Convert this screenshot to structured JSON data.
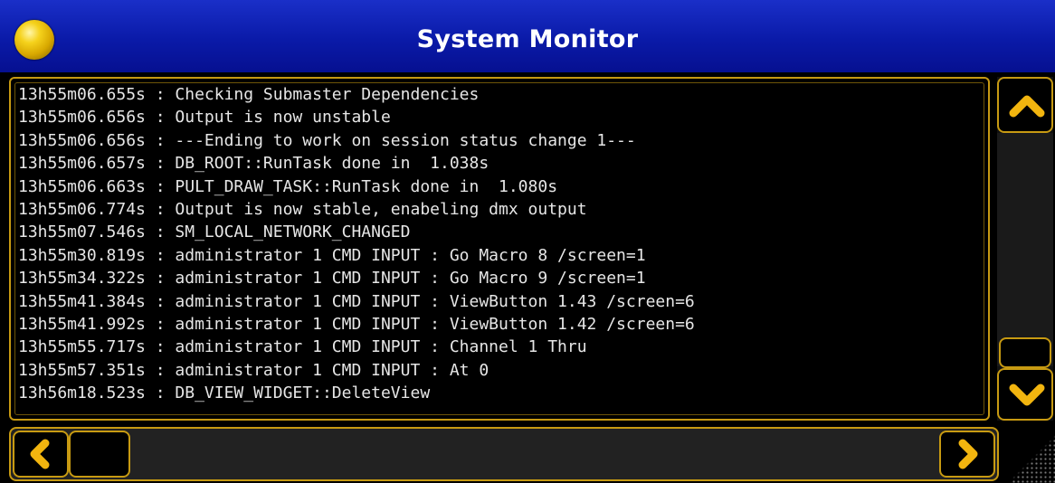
{
  "window": {
    "title": "System Monitor"
  },
  "log": {
    "lines": [
      "13h55m06.655s : Checking Submaster Dependencies",
      "13h55m06.656s : Output is now unstable",
      "13h55m06.656s : ---Ending to work on session status change 1---",
      "13h55m06.657s : DB_ROOT::RunTask done in  1.038s",
      "13h55m06.663s : PULT_DRAW_TASK::RunTask done in  1.080s",
      "13h55m06.774s : Output is now stable, enabeling dmx output",
      "13h55m07.546s : SM_LOCAL_NETWORK_CHANGED",
      "13h55m30.819s : administrator 1 CMD INPUT : Go Macro 8 /screen=1",
      "13h55m34.322s : administrator 1 CMD INPUT : Go Macro 9 /screen=1",
      "13h55m41.384s : administrator 1 CMD INPUT : ViewButton 1.43 /screen=6",
      "13h55m41.992s : administrator 1 CMD INPUT : ViewButton 1.42 /screen=6",
      "13h55m55.717s : administrator 1 CMD INPUT : Channel 1 Thru",
      "13h55m57.351s : administrator 1 CMD INPUT : At 0",
      "13h56m18.523s : DB_VIEW_WIDGET::DeleteView"
    ]
  },
  "icons": {
    "title_orb": "yellow-orb-icon",
    "scroll_up": "chevron-up-icon",
    "scroll_down": "chevron-down-icon",
    "scroll_left": "chevron-left-icon",
    "scroll_right": "chevron-right-icon",
    "resize": "resize-grip-icon"
  },
  "colors": {
    "title_bar": "#0a1aa8",
    "accent_border": "#c79a12",
    "chevron": "#f2b50f",
    "log_text": "#e6e6e6",
    "background": "#000000"
  }
}
